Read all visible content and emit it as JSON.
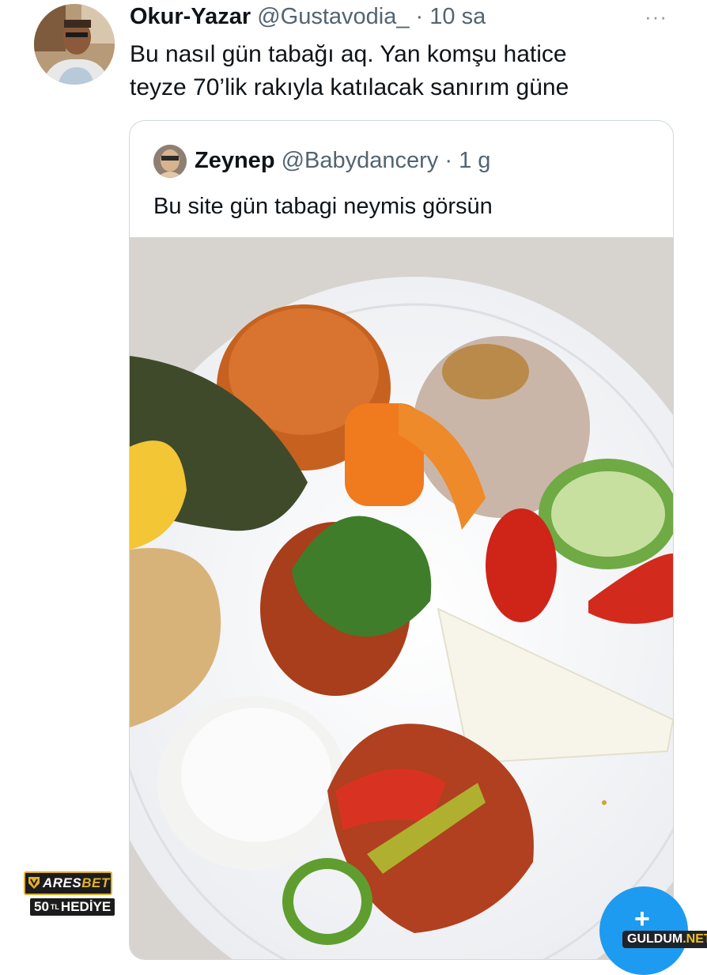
{
  "tweet": {
    "author_name": "Okur-Yazar",
    "author_handle": "@Gustavodia_",
    "separator": "·",
    "timestamp": "10 sa",
    "text_line1": "Bu nasıl gün tabağı aq. Yan komşu hatice",
    "text_line2": "teyze 70’lik rakıyla katılacak sanırım güne",
    "more_label": "···"
  },
  "quoted_tweet": {
    "author_name": "Zeynep",
    "author_handle": "@Babydancery",
    "separator": "·",
    "timestamp": "1 g",
    "text": "Bu site gün tabagi neymis görsün",
    "media": "food-plate-photo"
  },
  "ad": {
    "brand_prefix": "ARES",
    "brand_suffix": "BET",
    "offer": "50",
    "currency": "TL",
    "offer_label": "HEDİYE"
  },
  "fab": {
    "icon": "compose-plus-icon"
  },
  "watermark": {
    "text_main": "GULDUM",
    "text_tld": ".NET"
  },
  "colors": {
    "accent": "#1d9bf0",
    "muted": "#536471",
    "border": "#cfd9de",
    "ad_gold": "#e1b12c"
  }
}
